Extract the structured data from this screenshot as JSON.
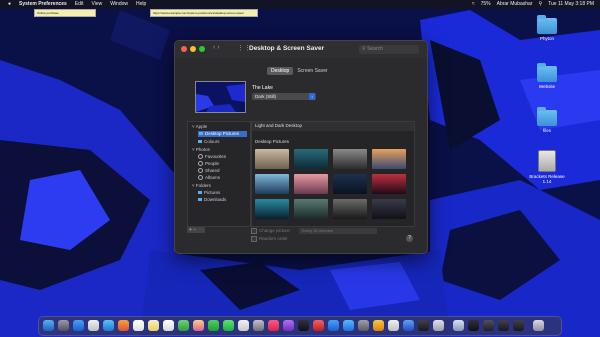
{
  "menubar": {
    "app_name": "System Preferences",
    "menus": [
      "Edit",
      "View",
      "Window",
      "Help"
    ],
    "status": {
      "battery": "75%",
      "user": "Abrar Mubashar",
      "clock": "Tue 11 May  3:18 PM"
    }
  },
  "url_bars": [
    "Online purchase",
    "https://www.example.com/system-preferences/desktop-screen-saver"
  ],
  "desktop_icons": [
    {
      "label": "Phyton",
      "type": "folder"
    },
    {
      "label": "Website",
      "type": "folder"
    },
    {
      "label": "files",
      "type": "folder"
    },
    {
      "label": "Brackets Release 1.14",
      "type": "drive"
    }
  ],
  "window": {
    "title": "Desktop & Screen Saver",
    "search_placeholder": "Search",
    "tabs": [
      {
        "label": "Desktop",
        "active": true
      },
      {
        "label": "Screen Saver",
        "active": false
      }
    ],
    "wallpaper_name": "The Lake",
    "appearance_value": "Dark (Still)",
    "sidebar": {
      "groups": [
        {
          "label": "Apple",
          "items": [
            {
              "label": "Desktop Pictures",
              "selected": true,
              "icon": "folder-icon"
            },
            {
              "label": "Colours",
              "selected": false,
              "icon": "folder-icon"
            }
          ]
        },
        {
          "label": "Photos",
          "items": [
            {
              "label": "Favourites",
              "icon": "heart-icon"
            },
            {
              "label": "People",
              "icon": "person-icon"
            },
            {
              "label": "Shared",
              "icon": "shared-icon"
            },
            {
              "label": "Albums",
              "icon": "album-icon"
            }
          ]
        },
        {
          "label": "Folders",
          "items": [
            {
              "label": "Pictures",
              "icon": "folder-icon"
            },
            {
              "label": "Downloads",
              "icon": "folder-icon"
            }
          ]
        }
      ]
    },
    "content": {
      "light_dark_label": "Light and Dark Desktop",
      "section_label": "Desktop Pictures"
    },
    "add_remove": "+  −",
    "change_picture_label": "Change picture:",
    "change_interval": "Every 30 minutes",
    "random_order_label": "Random order",
    "help_label": "?"
  },
  "colors": {
    "accent": "#3b6ac8",
    "wallpaper_blue": "#1a2ad8"
  }
}
